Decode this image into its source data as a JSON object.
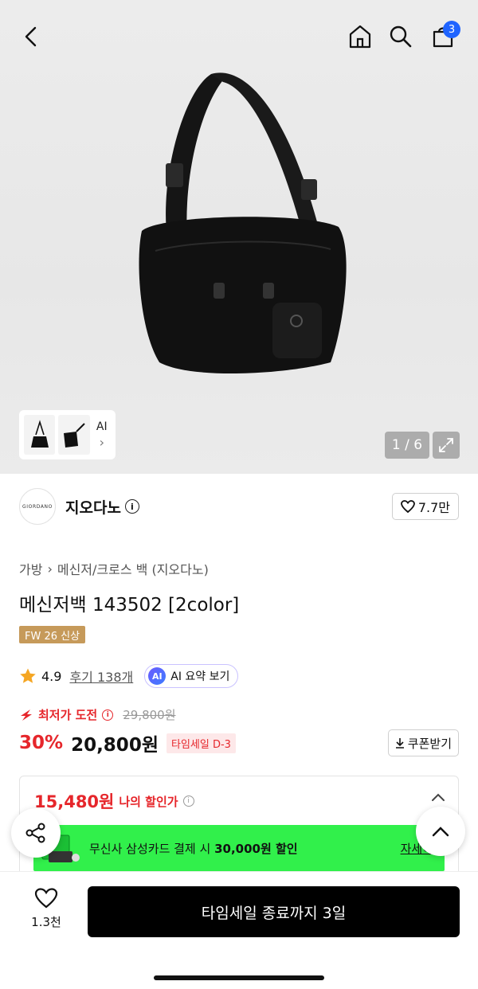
{
  "header": {
    "cart_count": "3"
  },
  "gallery": {
    "thumb_ai_label": "AI",
    "pager": "1 / 6"
  },
  "brand": {
    "logo_text": "GIORDANO",
    "name": "지오다노",
    "likes": "7.7만"
  },
  "product": {
    "breadcrumb": [
      "가방",
      "메신저/크로스 백 (지오다노)"
    ],
    "title": "메신저백 143502 [2color]",
    "season_tag": "FW 26 신상",
    "rating": "4.9",
    "reviews": "후기 138개",
    "ai_chip_badge": "AI",
    "ai_chip_label": "AI 요약 보기"
  },
  "pricing": {
    "lowest_label": "최저가 도전",
    "original_price": "29,800원",
    "discount": "30%",
    "price": "20,800원",
    "timesale": "타임세일 D-3",
    "coupon_label": "쿠폰받기",
    "my_price": "15,480원",
    "my_price_label": "나의 할인가"
  },
  "promo": {
    "text_prefix": "무신사 삼성카드 결제 시 ",
    "text_bold": "30,000원 할인",
    "detail_label": "자세히"
  },
  "bottom": {
    "wish_count": "1.3천",
    "buy_label": "타임세일 종료까지 3일"
  },
  "colors": {
    "accent_red": "#e6262b",
    "badge_blue": "#1f64ff",
    "promo_green": "#31f04b",
    "season_tag": "#c69a5a"
  }
}
